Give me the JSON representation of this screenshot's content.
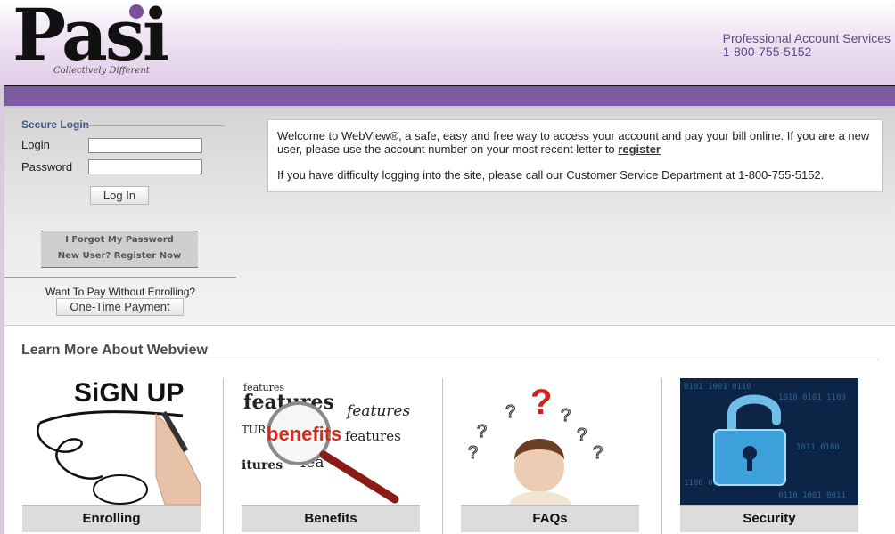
{
  "header": {
    "logo_word": "Pasi",
    "tagline": "Collectively Different",
    "dept": "Professional Account Services",
    "phone": "1-800-755-5152"
  },
  "login": {
    "legend": "Secure Login",
    "login_label": "Login",
    "password_label": "Password",
    "login_value": "",
    "password_value": "",
    "login_button": "Log In",
    "forgot_link": "I Forgot My Password",
    "register_link": "New User? Register Now",
    "pay_question": "Want To Pay Without Enrolling?",
    "pay_button": "One-Time Payment"
  },
  "welcome": {
    "line1": "Welcome to WebView®, a safe, easy and free way to access your account and pay your bill online. If you are a new user, please use the account number on your most recent letter to",
    "register": "register",
    "line2": "If you have difficulty logging into the site, please call our Customer Service Department at 1-800-755-5152."
  },
  "learn": {
    "title": "Learn More About Webview",
    "tiles": [
      {
        "label": "Enrolling",
        "image_text": "SiGN UP"
      },
      {
        "label": "Benefits",
        "image_text": "benefits"
      },
      {
        "label": "FAQs",
        "image_text": "?"
      },
      {
        "label": "Security",
        "image_text": ""
      }
    ]
  },
  "colors": {
    "accent_purple": "#7b5a9f",
    "link_blue": "#3e5a7e"
  }
}
